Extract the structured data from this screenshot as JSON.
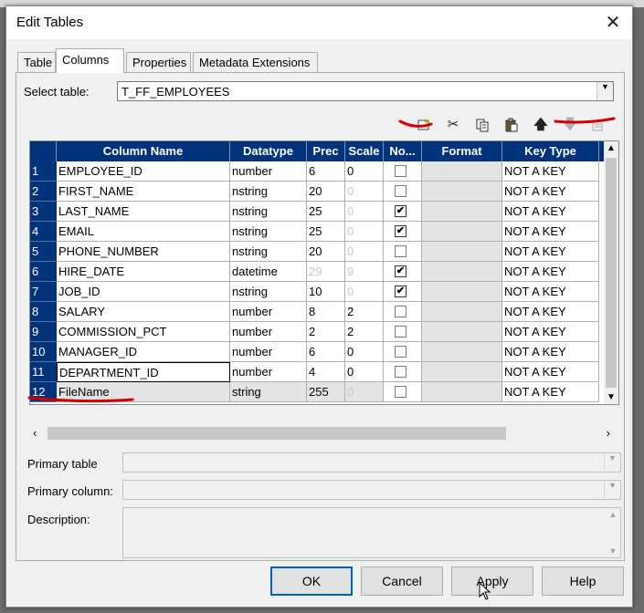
{
  "window": {
    "title": "Edit Tables"
  },
  "tabs": [
    {
      "label": "Table"
    },
    {
      "label": "Columns"
    },
    {
      "label": "Properties"
    },
    {
      "label": "Metadata Extensions"
    }
  ],
  "columns_tab": {
    "select_table_label": "Select table:",
    "select_table_value": "T_FF_EMPLOYEES",
    "toolbar_icons": [
      "new-column-icon",
      "cut-icon",
      "copy-icon",
      "paste-icon",
      "move-up-icon",
      "move-down-icon",
      "import-icon"
    ],
    "grid": {
      "headers": [
        "Column Name",
        "Datatype",
        "Prec",
        "Scale",
        "No...",
        "Format",
        "Key Type"
      ],
      "rows": [
        {
          "num": "1",
          "name": "EMPLOYEE_ID",
          "datatype": "number",
          "prec": "6",
          "scale": "0",
          "scale_disabled": false,
          "not_null": false,
          "format": "",
          "key": "NOT A KEY"
        },
        {
          "num": "2",
          "name": "FIRST_NAME",
          "datatype": "nstring",
          "prec": "20",
          "scale": "0",
          "scale_disabled": true,
          "not_null": false,
          "format": "",
          "key": "NOT A KEY"
        },
        {
          "num": "3",
          "name": "LAST_NAME",
          "datatype": "nstring",
          "prec": "25",
          "scale": "0",
          "scale_disabled": true,
          "not_null": true,
          "format": "",
          "key": "NOT A KEY"
        },
        {
          "num": "4",
          "name": "EMAIL",
          "datatype": "nstring",
          "prec": "25",
          "scale": "0",
          "scale_disabled": true,
          "not_null": true,
          "format": "",
          "key": "NOT A KEY"
        },
        {
          "num": "5",
          "name": "PHONE_NUMBER",
          "datatype": "nstring",
          "prec": "20",
          "scale": "0",
          "scale_disabled": true,
          "not_null": false,
          "format": "",
          "key": "NOT A KEY"
        },
        {
          "num": "6",
          "name": "HIRE_DATE",
          "datatype": "datetime",
          "prec": "29",
          "prec_disabled": true,
          "scale": "9",
          "scale_disabled": true,
          "not_null": true,
          "format": "",
          "key": "NOT A KEY"
        },
        {
          "num": "7",
          "name": "JOB_ID",
          "datatype": "nstring",
          "prec": "10",
          "scale": "0",
          "scale_disabled": true,
          "not_null": true,
          "format": "",
          "key": "NOT A KEY"
        },
        {
          "num": "8",
          "name": "SALARY",
          "datatype": "number",
          "prec": "8",
          "scale": "2",
          "scale_disabled": false,
          "not_null": false,
          "format": "",
          "key": "NOT A KEY"
        },
        {
          "num": "9",
          "name": "COMMISSION_PCT",
          "datatype": "number",
          "prec": "2",
          "scale": "2",
          "scale_disabled": false,
          "not_null": false,
          "format": "",
          "key": "NOT A KEY"
        },
        {
          "num": "10",
          "name": "MANAGER_ID",
          "datatype": "number",
          "prec": "6",
          "scale": "0",
          "scale_disabled": false,
          "not_null": false,
          "format": "",
          "key": "NOT A KEY"
        },
        {
          "num": "11",
          "name": "DEPARTMENT_ID",
          "datatype": "number",
          "prec": "4",
          "scale": "0",
          "scale_disabled": false,
          "not_null": false,
          "format": "",
          "key": "NOT A KEY"
        },
        {
          "num": "12",
          "name": "FileName",
          "datatype": "string",
          "prec": "255",
          "scale": "0",
          "scale_disabled": true,
          "not_null": false,
          "format": "",
          "key": "NOT A KEY"
        }
      ]
    },
    "primary_table_label": "Primary table",
    "primary_column_label": "Primary column:",
    "description_label": "Description:"
  },
  "buttons": {
    "ok": "OK",
    "cancel": "Cancel",
    "apply": "Apply",
    "help": "Help"
  },
  "colors": {
    "grid_header": "#00337a",
    "annotation_red": "#d40000"
  }
}
